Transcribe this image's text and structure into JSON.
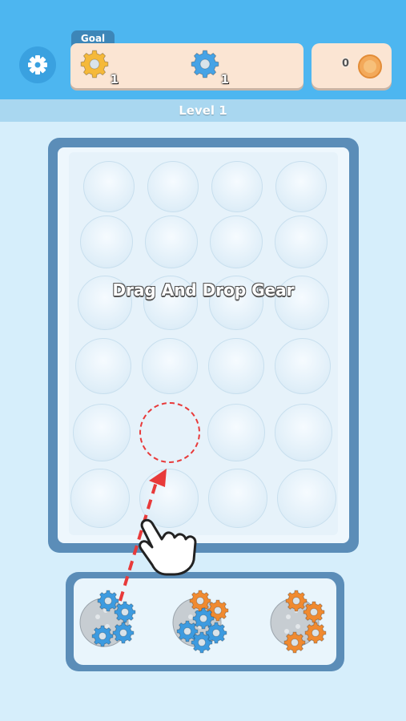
{
  "header": {
    "settings_icon": "gear-icon",
    "goal_label": "Goal",
    "goals": [
      {
        "color": "#f5b93a",
        "count": "1"
      },
      {
        "color": "#46a3e6",
        "count": "1"
      }
    ],
    "coins": "0"
  },
  "level": {
    "label": "Level 1"
  },
  "board": {
    "hint": "Drag And Drop Gear",
    "rows": 6,
    "cols": 4,
    "target_slot": {
      "row": 5,
      "col": 2
    }
  },
  "tray": {
    "stacks": [
      {
        "name": "stack-1",
        "colors": [
          "#3d9be0",
          "#3d9be0",
          "#3d9be0",
          "#3d9be0"
        ]
      },
      {
        "name": "stack-2",
        "colors": [
          "#f08a30",
          "#f08a30",
          "#3d9be0",
          "#3d9be0",
          "#3d9be0",
          "#3d9be0"
        ]
      },
      {
        "name": "stack-3",
        "colors": [
          "#f08a30",
          "#f08a30",
          "#f08a30",
          "#f08a30"
        ]
      }
    ]
  },
  "colors": {
    "blue": "#3d9be0",
    "orange": "#f08a30",
    "gold": "#f5b93a",
    "arrow": "#e83a3a"
  }
}
